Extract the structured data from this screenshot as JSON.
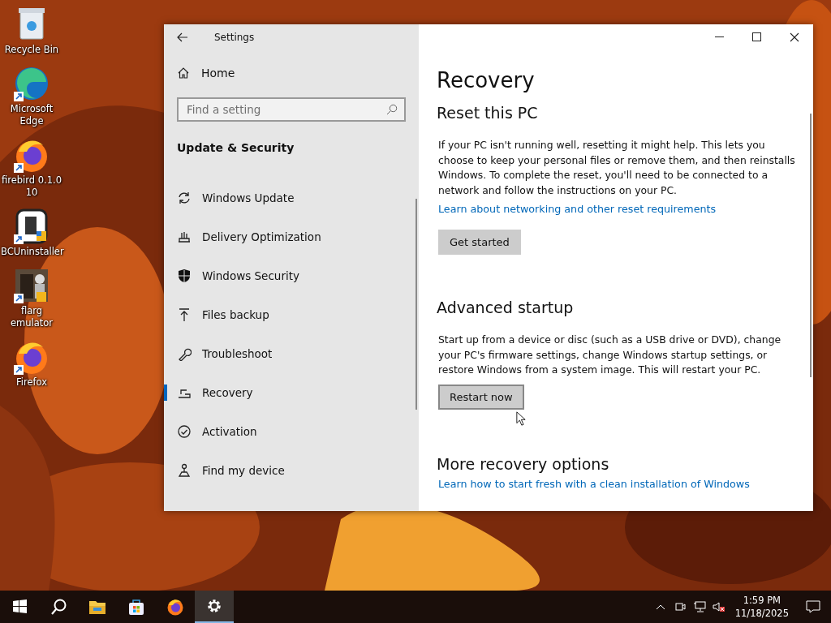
{
  "desktop": {
    "icons": [
      {
        "label": "Recycle Bin",
        "kind": "bin"
      },
      {
        "label": "Microsoft Edge",
        "kind": "edge"
      },
      {
        "label": "firebird 0.1.0 10",
        "kind": "firefox"
      },
      {
        "label": "BCUninstaller",
        "kind": "bcu"
      },
      {
        "label": "flarg emulator",
        "kind": "flarg"
      },
      {
        "label": "Firefox",
        "kind": "firefox"
      }
    ]
  },
  "window": {
    "title": "Settings",
    "sidebar": {
      "home": "Home",
      "search": {
        "placeholder": "Find a setting"
      },
      "section": "Update & Security",
      "items": [
        {
          "label": "Windows Update",
          "selected": false
        },
        {
          "label": "Delivery Optimization",
          "selected": false
        },
        {
          "label": "Windows Security",
          "selected": false
        },
        {
          "label": "Files backup",
          "selected": false
        },
        {
          "label": "Troubleshoot",
          "selected": false
        },
        {
          "label": "Recovery",
          "selected": true
        },
        {
          "label": "Activation",
          "selected": false
        },
        {
          "label": "Find my device",
          "selected": false
        }
      ]
    },
    "content": {
      "title": "Recovery",
      "sections": [
        {
          "heading": "Reset this PC",
          "text": "If your PC isn't running well, resetting it might help. This lets you choose to keep your personal files or remove them, and then reinstalls Windows. To complete the reset, you'll need to be connected to a network and follow the instructions on your PC.",
          "link": "Learn about networking and other reset requirements",
          "button": "Get started",
          "focused": false
        },
        {
          "heading": "Advanced startup",
          "text": "Start up from a device or disc (such as a USB drive or DVD), change your PC's firmware settings, change Windows startup settings, or restore Windows from a system image. This will restart your PC.",
          "button": "Restart now",
          "focused": true
        },
        {
          "heading": "More recovery options",
          "link": "Learn how to start fresh with a clean installation of Windows"
        }
      ]
    }
  },
  "taskbar": {
    "apps": [
      {
        "kind": "start",
        "selected": false
      },
      {
        "kind": "search",
        "selected": false
      },
      {
        "kind": "explorer",
        "selected": false
      },
      {
        "kind": "store",
        "selected": false
      },
      {
        "kind": "firefox",
        "selected": false
      },
      {
        "kind": "settings",
        "selected": true
      }
    ],
    "tray": {
      "time": "1:59 PM",
      "date": "11/18/2025",
      "muted": true
    }
  }
}
